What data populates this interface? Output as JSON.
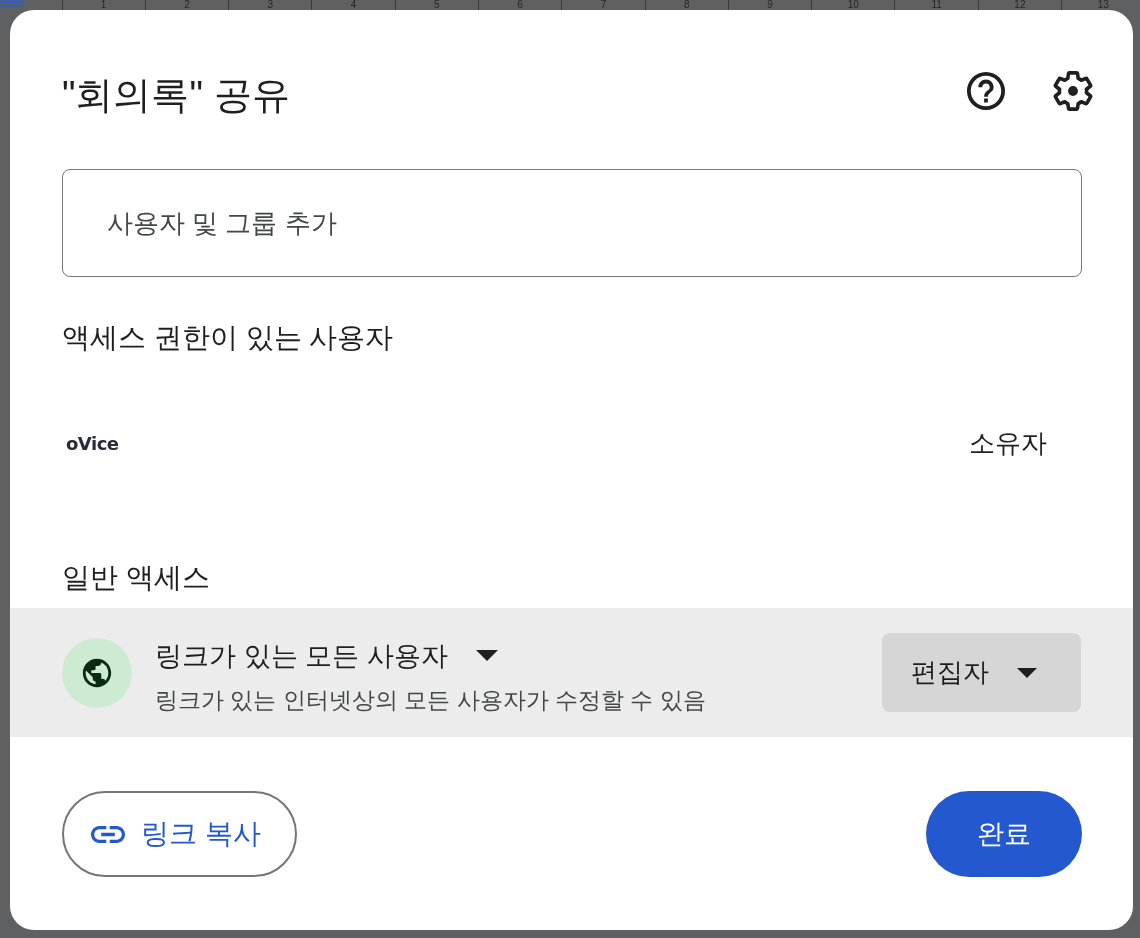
{
  "background": {
    "ruler": {
      "marks": [
        "1",
        "2",
        "3",
        "4",
        "5",
        "6",
        "7",
        "8",
        "9",
        "10",
        "11",
        "12",
        "13"
      ]
    }
  },
  "dialog": {
    "title": "\"회의록\" 공유",
    "add_people": {
      "placeholder": "사용자 및 그룹 추가"
    },
    "people_section": {
      "heading": "액세스 권한이 있는 사용자",
      "people": [
        {
          "logo": "oVice",
          "role": "소유자"
        }
      ]
    },
    "general_access": {
      "heading": "일반 액세스",
      "scope": "링크가 있는 모든 사용자",
      "description": "링크가 있는 인터넷상의 모든 사용자가 수정할 수 있음",
      "role": "편집자"
    },
    "buttons": [
      {
        "kind": "outlined",
        "label": "링크 복사"
      },
      {
        "kind": "filled",
        "label": "완료"
      }
    ]
  }
}
